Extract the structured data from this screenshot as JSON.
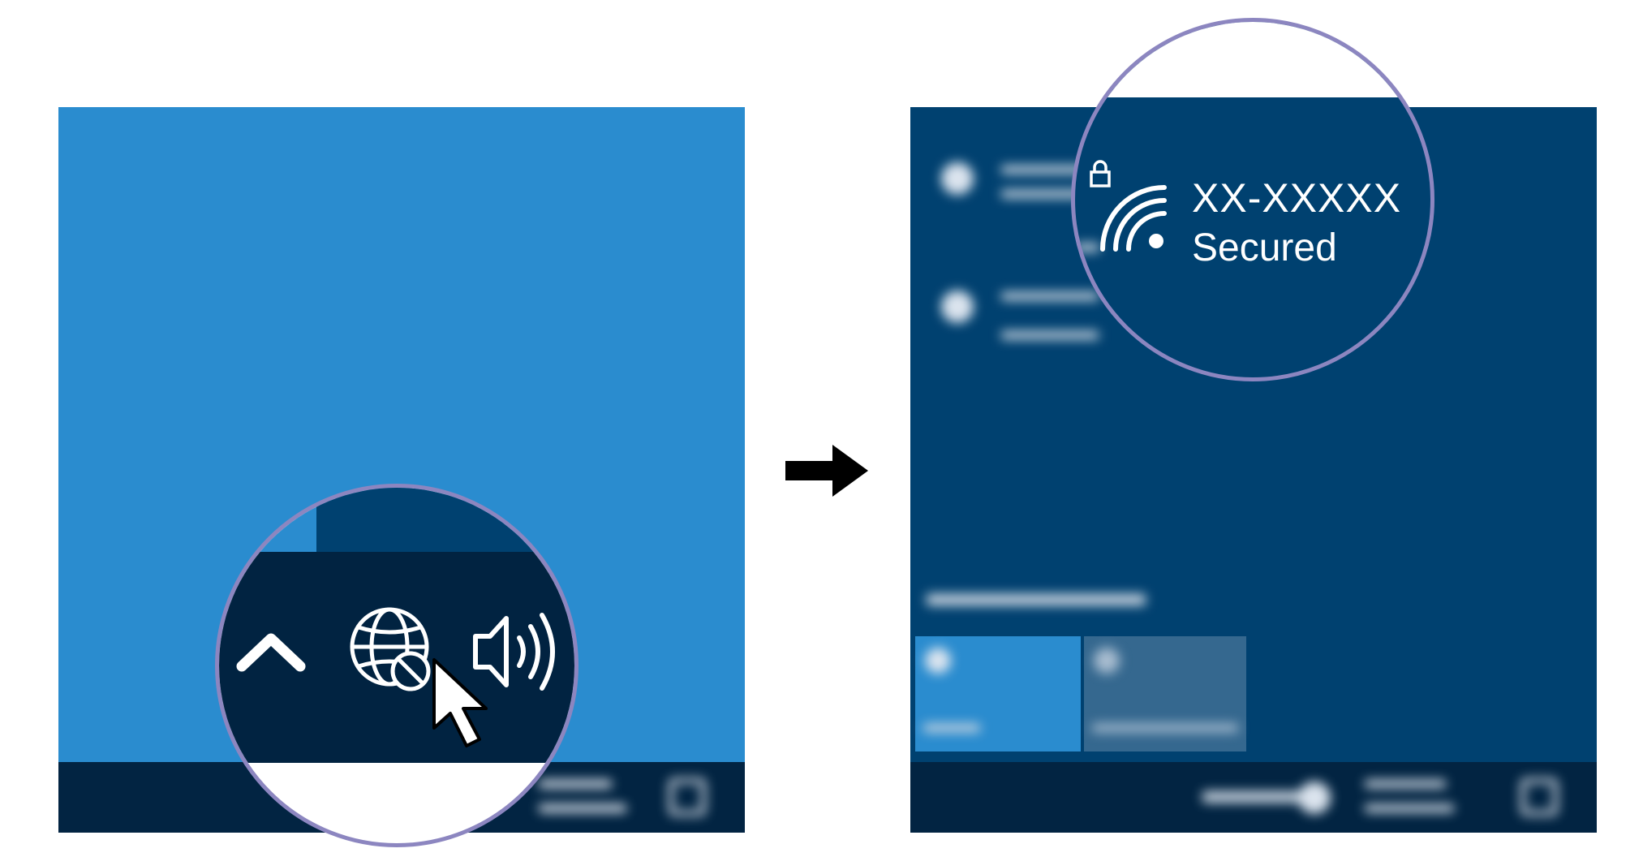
{
  "colors": {
    "desktop_blue": "#2a8ccf",
    "flyout_blue": "#004170",
    "taskbar_navy": "#022442",
    "zoom_ring": "#8c86c0",
    "icon_white": "#ffffff"
  },
  "left_panel": {
    "tray_icons": [
      "chevron-up-icon",
      "globe-no-internet-icon",
      "speaker-volume-icon",
      "mouse-pointer-icon"
    ]
  },
  "arrow": {
    "icon": "arrow-right-icon"
  },
  "right_panel": {
    "network": {
      "name": "XX-XXXXX",
      "status": "Secured",
      "icons": [
        "lock-icon",
        "wifi-icon"
      ]
    }
  }
}
